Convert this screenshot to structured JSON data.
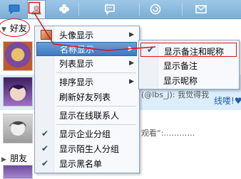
{
  "tabs": [
    {
      "name": "chat-bubble-tab",
      "icon": "chat-bubble-icon"
    },
    {
      "name": "friends-tab",
      "icon": "user-icon"
    },
    {
      "name": "clover-tab",
      "icon": "clover-icon"
    },
    {
      "name": "messages-tab",
      "icon": "message-icon"
    },
    {
      "name": "space-tab",
      "icon": "spiral-icon"
    },
    {
      "name": "mail-tab",
      "icon": "envelope-icon"
    }
  ],
  "groups": {
    "friends": "好友",
    "friends2": "朋友"
  },
  "contacts": {
    "status_fragment": "(@lbs_j): 我觉得我",
    "link_fragment": "线喽!♥♥",
    "watch_fragment": "观看“:…………"
  },
  "context_menu": {
    "items": [
      {
        "label": "头像显示",
        "has_submenu": true,
        "checked": false
      },
      {
        "label": "名称显示",
        "has_submenu": true,
        "checked": false,
        "highlighted": true
      },
      {
        "label": "列表显示",
        "has_submenu": true,
        "checked": false
      },
      {
        "label": "排序显示",
        "has_submenu": true,
        "checked": false
      },
      {
        "label": "刷新好友列表",
        "has_submenu": false,
        "checked": false
      },
      {
        "label": "显示在线联系人",
        "has_submenu": false,
        "checked": false
      },
      {
        "label": "显示企业分组",
        "has_submenu": false,
        "checked": true
      },
      {
        "label": "显示陌生人分组",
        "has_submenu": false,
        "checked": true
      },
      {
        "label": "显示黑名单",
        "has_submenu": false,
        "checked": true
      }
    ],
    "submenu_glyph": "▶",
    "check_glyph": "✔"
  },
  "name_submenu": {
    "items": [
      {
        "label": "显示备注和昵称",
        "checked": true
      },
      {
        "label": "显示备注",
        "checked": false
      },
      {
        "label": "显示昵称",
        "checked": false
      }
    ]
  },
  "colors": {
    "annotation": "#dd1111",
    "highlight": "#3f78c0",
    "tabbar": "#8fbde0"
  }
}
